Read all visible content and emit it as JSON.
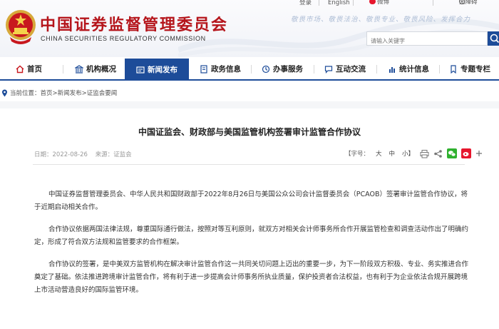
{
  "header": {
    "title": "中国证券监督管理委员会",
    "subtitle": "CHINA SECURITIES REGULATORY COMMISSION",
    "slogan": "敬畏市场、敬畏法治、敬畏专业、敬畏风险、发挥合力",
    "links": [
      "登录",
      "English",
      "微博",
      "无障碍"
    ],
    "search_placeholder": "请输入关键字"
  },
  "nav": {
    "items": [
      {
        "label": "首页",
        "icon": "home-icon"
      },
      {
        "label": "机构概况",
        "icon": "building-icon"
      },
      {
        "label": "新闻发布",
        "icon": "news-icon"
      },
      {
        "label": "政务信息",
        "icon": "gov-info-icon"
      },
      {
        "label": "办事服务",
        "icon": "service-icon"
      },
      {
        "label": "互动交流",
        "icon": "chat-icon"
      },
      {
        "label": "统计信息",
        "icon": "chart-icon"
      },
      {
        "label": "专题专栏",
        "icon": "bookmark-icon"
      }
    ],
    "active": "新闻发布"
  },
  "breadcrumb": {
    "prefix": "当前位置：",
    "path": "首页>新闻发布>证监会要闻"
  },
  "article": {
    "title": "中国证监会、财政部与美国监管机构签署审计监管合作协议",
    "date_label": "日期：2022-08-26",
    "source_label": "来源：证监会",
    "font_label": "【字号：",
    "font_large": "大",
    "font_medium": "中",
    "font_small": "小】",
    "paragraphs": [
      [
        "中国证券监督管理委员会、中华人民共和国财政部于2022年8月26日与美国公众公司会计监督委员会（PCAOB）签署审计监管合作协议，将",
        "于近期启动相关合作。"
      ],
      [
        "合作协议依据两国法律法规，尊重国际通行做法，按照对等互利原则，就双方对相关会计师事务所合作开展监管检查和调查活动作出了明确约",
        "定，形成了符合双方法规和监管要求的合作框架。"
      ],
      [
        "合作协议的签署，是中美双方监管机构在解决审计监管合作这一共同关切问题上迈出的重要一步，为下一阶段双方积极、专业、务实推进合作",
        "奠定了基础。依法推进跨境审计监管合作，将有利于进一步提高会计师事务所执业质量，保护投资者合法权益，也有利于为企业依法合规开展跨境",
        "上市活动营造良好的国际监管环境。"
      ]
    ]
  },
  "colors": {
    "brand_red": "#b5151b",
    "nav_blue": "#1d4c99",
    "wechat_green": "#2fb12f",
    "weibo_red": "#e6162d"
  }
}
